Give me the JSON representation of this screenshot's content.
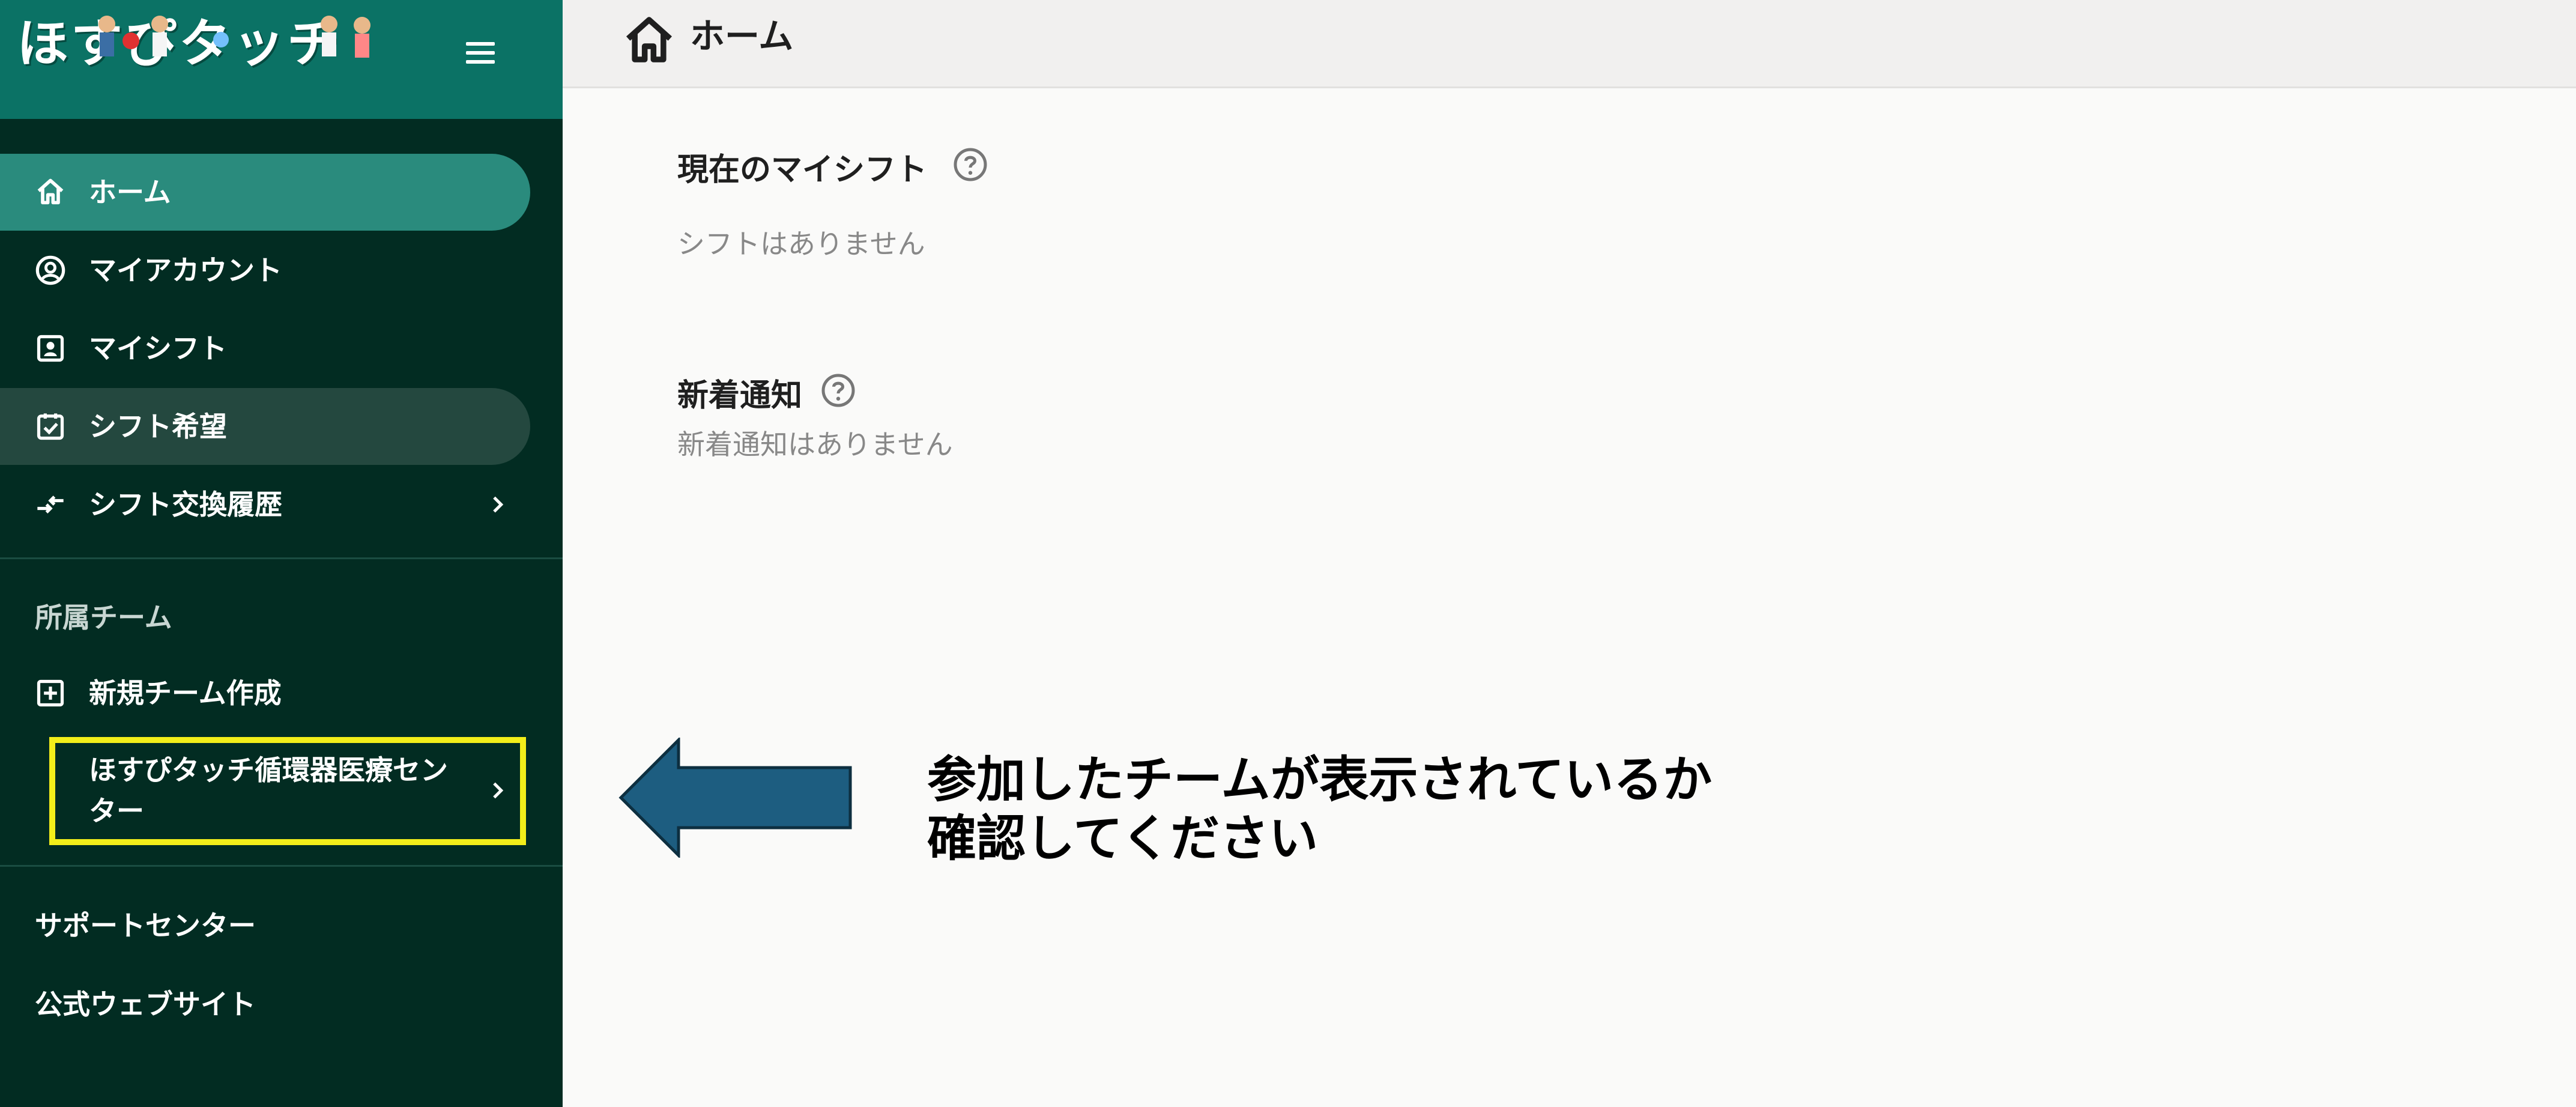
{
  "app": {
    "logo_text": "ほすぴタッチ",
    "menu_icon": "hamburger-menu-icon"
  },
  "sidebar": {
    "items": [
      {
        "label": "ホーム",
        "icon": "home-icon",
        "state": "active"
      },
      {
        "label": "マイアカウント",
        "icon": "account-circle-icon"
      },
      {
        "label": "マイシフト",
        "icon": "badge-icon"
      },
      {
        "label": "シフト希望",
        "icon": "checkbox-calendar-icon",
        "state": "hover"
      },
      {
        "label": "シフト交換履歴",
        "icon": "swap-arrows-icon",
        "chevron": true
      }
    ],
    "team_section": {
      "label": "所属チーム",
      "create_label": "新規チーム作成",
      "create_icon": "plus-square-icon",
      "team_name": "ほすぴタッチ循環器医療センター",
      "highlight_color": "#f3ee1a"
    },
    "footer": {
      "support": "サポートセンター",
      "website": "公式ウェブサイト"
    }
  },
  "topbar": {
    "title": "ホーム",
    "icon": "home-icon"
  },
  "main": {
    "my_shift": {
      "title": "現在のマイシフト",
      "empty": "シフトはありません"
    },
    "notifications": {
      "title": "新着通知",
      "empty": "新着通知はありません"
    }
  },
  "annotation": {
    "line1": "参加したチームが表示されているか",
    "line2": "確認してください",
    "arrow_color": "#1d5d80"
  },
  "colors": {
    "sidebar_bg": "#022c22",
    "header_bg": "#0b7265",
    "active_item": "#2a8b7d",
    "content_bg": "#fafaf9"
  }
}
